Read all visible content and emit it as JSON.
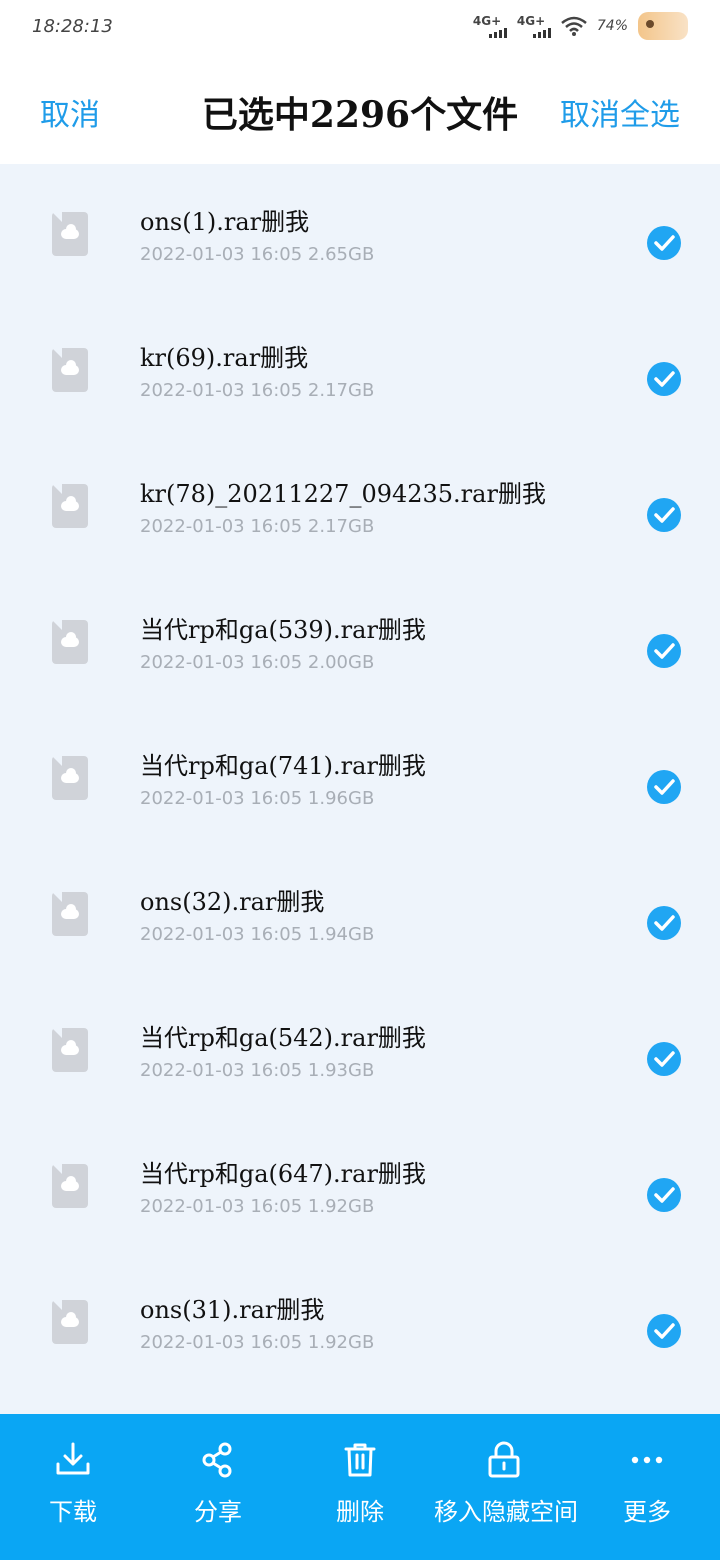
{
  "status_bar": {
    "time": "18:28:13",
    "net1": "4G+",
    "net2": "4G+",
    "battery": "74%"
  },
  "header": {
    "left_action": "取消",
    "title": "已选中2296个文件",
    "right_action": "取消全选"
  },
  "files": [
    {
      "name": "ons(1).rar删我",
      "meta": "2022-01-03  16:05    2.65GB"
    },
    {
      "name": "kr(69).rar删我",
      "meta": "2022-01-03  16:05    2.17GB"
    },
    {
      "name": "kr(78)_20211227_094235.rar删我",
      "meta": "2022-01-03  16:05    2.17GB"
    },
    {
      "name": "当代rp和ga(539).rar删我",
      "meta": "2022-01-03  16:05    2.00GB"
    },
    {
      "name": "当代rp和ga(741).rar删我",
      "meta": "2022-01-03  16:05    1.96GB"
    },
    {
      "name": "ons(32).rar删我",
      "meta": "2022-01-03  16:05    1.94GB"
    },
    {
      "name": "当代rp和ga(542).rar删我",
      "meta": "2022-01-03  16:05    1.93GB"
    },
    {
      "name": "当代rp和ga(647).rar删我",
      "meta": "2022-01-03  16:05    1.92GB"
    },
    {
      "name": "ons(31).rar删我",
      "meta": "2022-01-03  16:05    1.92GB"
    }
  ],
  "bottom_actions": [
    {
      "label": "下载",
      "icon": "download-icon"
    },
    {
      "label": "分享",
      "icon": "share-icon"
    },
    {
      "label": "删除",
      "icon": "trash-icon"
    },
    {
      "label": "移入隐藏空间",
      "icon": "lock-icon"
    },
    {
      "label": "更多",
      "icon": "more-icon"
    }
  ],
  "colors": {
    "accent": "#1f9ce9",
    "bottom_bar": "#0aa6f4",
    "check": "#20a6f3",
    "list_bg": "#eef4fb"
  }
}
